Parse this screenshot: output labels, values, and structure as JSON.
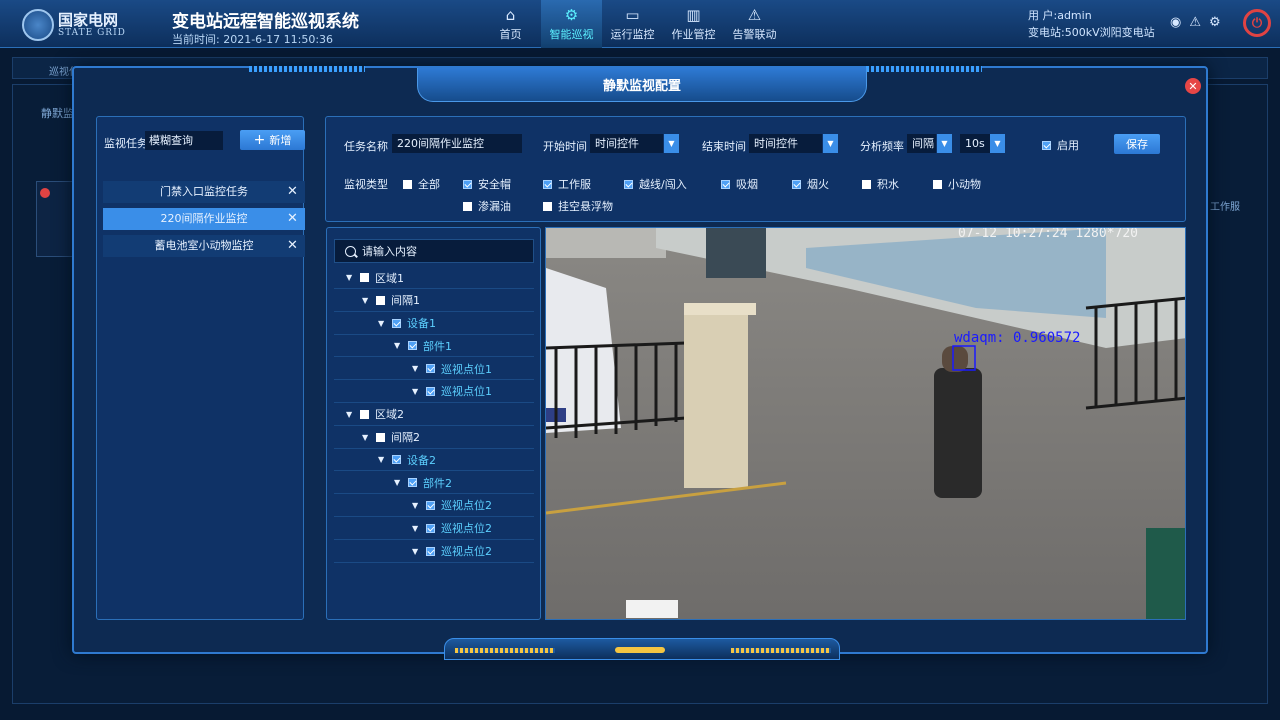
{
  "header": {
    "logo_cn": "国家电网",
    "logo_en": "STATE GRID",
    "system_title": "变电站远程智能巡视系统",
    "current_time_label": "当前时间:",
    "current_time": "2021-6-17  11:50:36",
    "nav": [
      {
        "label": "首页",
        "icon": "home-icon"
      },
      {
        "label": "智能巡视",
        "icon": "gear-icon"
      },
      {
        "label": "运行监控",
        "icon": "monitor-icon"
      },
      {
        "label": "作业管控",
        "icon": "book-icon"
      },
      {
        "label": "告警联动",
        "icon": "warning-icon"
      }
    ],
    "user_label": "用    户:",
    "user_name": "admin",
    "station_label": "变电站:",
    "station_name": "500kV浏阳变电站"
  },
  "background": {
    "strip_label": "巡视任",
    "panel_tag": "静默监",
    "right_text": "工作服"
  },
  "modal": {
    "title": "静默监视配置",
    "close": "✕"
  },
  "task_panel": {
    "label": "监视任务",
    "search_value": "模糊查询",
    "add_label": "新增",
    "tasks": [
      {
        "name": "门禁入口监控任务",
        "active": false
      },
      {
        "name": "220间隔作业监控",
        "active": true
      },
      {
        "name": "蓄电池室小动物监控",
        "active": false
      }
    ]
  },
  "config": {
    "task_name_label": "任务名称",
    "task_name_value": "220间隔作业监控",
    "start_label": "开始时间",
    "start_value": "时间控件",
    "end_label": "结束时间",
    "end_value": "时间控件",
    "freq_label": "分析频率",
    "freq_unit": "间隔",
    "freq_value": "10s",
    "enable_label": "启用",
    "enabled": true,
    "save_label": "保存",
    "type_label": "监视类型",
    "types": [
      {
        "label": "全部",
        "checked": false
      },
      {
        "label": "安全帽",
        "checked": true
      },
      {
        "label": "工作服",
        "checked": true
      },
      {
        "label": "越线/闯入",
        "checked": true
      },
      {
        "label": "吸烟",
        "checked": true
      },
      {
        "label": "烟火",
        "checked": true
      },
      {
        "label": "积水",
        "checked": false
      },
      {
        "label": "小动物",
        "checked": false
      },
      {
        "label": "渗漏油",
        "checked": false
      },
      {
        "label": "挂空悬浮物",
        "checked": false
      }
    ]
  },
  "tree": {
    "search_placeholder": "请输入内容",
    "nodes": [
      {
        "label": "区域1",
        "level": 0,
        "checked": false
      },
      {
        "label": "间隔1",
        "level": 1,
        "checked": false
      },
      {
        "label": "设备1",
        "level": 2,
        "checked": true
      },
      {
        "label": "部件1",
        "level": 3,
        "checked": true
      },
      {
        "label": "巡视点位1",
        "level": 4,
        "checked": true
      },
      {
        "label": "巡视点位1",
        "level": 4,
        "checked": true
      },
      {
        "label": "区域2",
        "level": 0,
        "checked": false
      },
      {
        "label": "间隔2",
        "level": 1,
        "checked": false
      },
      {
        "label": "设备2",
        "level": 2,
        "checked": true
      },
      {
        "label": "部件2",
        "level": 3,
        "checked": true
      },
      {
        "label": "巡视点位2",
        "level": 4,
        "checked": true
      },
      {
        "label": "巡视点位2",
        "level": 4,
        "checked": true
      },
      {
        "label": "巡视点位2",
        "level": 4,
        "checked": true
      }
    ]
  },
  "video": {
    "timestamp": "07-12 10:27:24 1280*720",
    "detection_label": "wdaqm: 0.960572"
  },
  "colors": {
    "accent": "#3a8ee8",
    "active_nav": "#5cf0ff",
    "danger": "#e64646",
    "detection": "#1a1aff"
  }
}
